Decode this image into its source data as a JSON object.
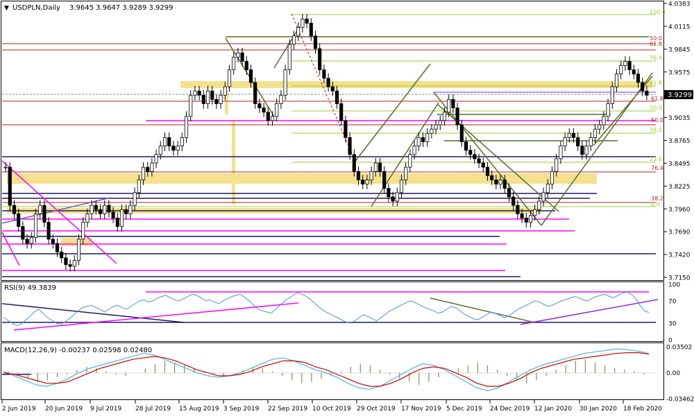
{
  "header": {
    "symbol": "USDPLN,Daily",
    "ohlc": "3.9645 3.9647 3.9289 3.9299"
  },
  "chart_data": [
    {
      "type": "candlestick",
      "panel": "price",
      "symbol": "USDPLN",
      "timeframe": "Daily",
      "open": 3.9645,
      "high": 3.9647,
      "low": 3.9289,
      "close": 3.9299,
      "current_price_label": "3.9299",
      "ylim": [
        3.715,
        4.0383
      ],
      "y_ticks": [
        "4.0383",
        "4.0115",
        "3.9845",
        "3.9575",
        "3.9305",
        "3.9035",
        "3.8765",
        "3.8495",
        "3.8225",
        "3.7960",
        "3.7690",
        "3.7420",
        "3.7150"
      ],
      "x_ticks": [
        "2 Jun 2019",
        "20 Jun 2019",
        "9 Jul 2019",
        "28 Jul 2019",
        "15 Aug 2019",
        "3 Sep 2019",
        "22 Sep 2019",
        "10 Oct 2019",
        "29 Oct 2019",
        "17 Nov 2019",
        "5 Dec 2019",
        "24 Dec 2019",
        "12 Jan 2020",
        "30 Jan 2020",
        "18 Feb 2020"
      ],
      "closes": [
        3.845,
        3.8,
        3.79,
        3.775,
        3.76,
        3.755,
        3.762,
        3.79,
        3.8,
        3.78,
        3.76,
        3.755,
        3.745,
        3.738,
        3.73,
        3.728,
        3.735,
        3.76,
        3.78,
        3.79,
        3.8,
        3.795,
        3.79,
        3.8,
        3.792,
        3.785,
        3.775,
        3.795,
        3.79,
        3.8,
        3.815,
        3.83,
        3.845,
        3.84,
        3.85,
        3.86,
        3.87,
        3.88,
        3.87,
        3.865,
        3.87,
        3.88,
        3.905,
        3.93,
        3.935,
        3.93,
        3.92,
        3.935,
        3.925,
        3.92,
        3.93,
        3.94,
        3.96,
        3.975,
        3.98,
        3.97,
        3.96,
        3.945,
        3.92,
        3.915,
        3.91,
        3.9,
        3.905,
        3.92,
        3.93,
        3.96,
        3.99,
        4.0,
        4.01,
        4.02,
        4.015,
        4.0,
        3.985,
        3.96,
        3.95,
        3.94,
        3.935,
        3.92,
        3.9,
        3.88,
        3.86,
        3.84,
        3.83,
        3.825,
        3.83,
        3.84,
        3.85,
        3.84,
        3.82,
        3.81,
        3.805,
        3.815,
        3.83,
        3.845,
        3.86,
        3.87,
        3.88,
        3.875,
        3.885,
        3.89,
        3.895,
        3.9,
        3.91,
        3.925,
        3.915,
        3.895,
        3.875,
        3.865,
        3.86,
        3.855,
        3.85,
        3.845,
        3.835,
        3.83,
        3.825,
        3.83,
        3.82,
        3.81,
        3.8,
        3.79,
        3.785,
        3.78,
        3.788,
        3.795,
        3.805,
        3.815,
        3.825,
        3.84,
        3.855,
        3.87,
        3.88,
        3.885,
        3.88,
        3.87,
        3.86,
        3.87,
        3.88,
        3.89,
        3.895,
        3.905,
        3.92,
        3.94,
        3.955,
        3.965,
        3.97,
        3.96,
        3.955,
        3.945,
        3.935,
        3.93
      ],
      "fib_left_labels": [
        "100.0",
        "50.0",
        "61.8",
        "76.4",
        "61.8",
        "50.0",
        "38.2",
        "23.6"
      ],
      "fib_right_labels": [
        "61.8",
        "50.0",
        "76.4",
        "38.2",
        "0.0"
      ],
      "colors": {
        "candles": "#000000",
        "green_lines": "#6b8e23",
        "fib_lines": "#9acd32",
        "resistance": "#b22222",
        "support": "#1a1a5e",
        "magenta": "#ff00ff",
        "zones": "#f5e08c",
        "rsi": "#4a90e2",
        "macd_signal": "#d00000",
        "macd_main": "#4ab4d8",
        "histogram": "#8b8b5a"
      }
    },
    {
      "type": "line",
      "panel": "rsi",
      "title": "RSI(9) 49.3839",
      "ylim": [
        0,
        100
      ],
      "y_ticks": [
        "100",
        "70",
        "30",
        "0"
      ],
      "values": [
        40,
        35,
        30,
        25,
        28,
        35,
        42,
        50,
        55,
        48,
        40,
        35,
        30,
        28,
        32,
        38,
        45,
        52,
        58,
        60,
        62,
        58,
        55,
        50,
        55,
        60,
        62,
        58,
        55,
        60,
        65,
        70,
        72,
        68,
        70,
        75,
        78,
        80,
        76,
        72,
        70,
        74,
        78,
        82,
        80,
        76,
        70,
        72,
        68,
        65,
        70,
        74,
        78,
        80,
        82,
        76,
        70,
        62,
        55,
        52,
        50,
        48,
        55,
        62,
        70,
        75,
        80,
        85,
        82,
        78,
        72,
        65,
        58,
        52,
        48,
        44,
        40,
        36,
        32,
        30,
        34,
        40,
        45,
        42,
        38,
        34,
        40,
        46,
        52,
        56,
        60,
        64,
        68,
        70,
        66,
        62,
        58,
        55,
        52,
        48,
        50,
        55,
        60,
        58,
        52,
        46,
        42,
        38,
        36,
        40,
        45,
        50,
        48,
        44,
        40,
        42,
        48,
        54,
        58,
        62,
        66,
        70,
        68,
        64,
        60,
        62,
        66,
        70,
        72,
        75,
        78,
        76,
        72,
        70,
        74,
        78,
        80,
        82,
        78,
        76,
        80,
        84,
        86,
        82,
        74,
        62,
        52,
        49.4
      ]
    },
    {
      "type": "bar",
      "panel": "macd",
      "title": "MACD(12,26,9) -0.00237 0.02598 0.02480",
      "ylim": [
        -0.03462,
        0.03502
      ],
      "y_ticks": [
        "0.03502",
        "0.00",
        "-0.03462"
      ],
      "histogram": [
        0.002,
        -0.004,
        -0.008,
        -0.012,
        -0.01,
        -0.006,
        -0.002,
        0.004,
        0.008,
        0.006,
        0.002,
        -0.002,
        -0.004,
        0.0,
        0.006,
        0.012,
        0.016,
        0.014,
        0.01,
        0.006,
        0.002,
        -0.002,
        -0.004,
        0.0,
        0.004,
        0.008,
        0.006,
        0.002,
        -0.004,
        -0.01,
        -0.014,
        -0.012,
        -0.008,
        -0.004,
        0.002,
        0.008,
        0.012,
        0.01,
        0.004,
        -0.002,
        -0.008,
        -0.012,
        -0.016,
        -0.012,
        -0.006,
        0.0,
        0.006,
        0.01,
        0.014,
        0.01,
        0.004,
        -0.004,
        -0.01,
        -0.014,
        -0.01,
        -0.004,
        0.004,
        0.01,
        0.016,
        0.018,
        0.014,
        0.01,
        0.006,
        0.004,
        0.002,
        -0.002
      ],
      "macd_line": [
        0.002,
        -0.004,
        -0.01,
        -0.016,
        -0.018,
        -0.014,
        -0.008,
        0.0,
        0.006,
        0.01,
        0.014,
        0.018,
        0.022,
        0.026,
        0.024,
        0.018,
        0.012,
        0.006,
        0.0,
        -0.004,
        -0.006,
        -0.004,
        0.0,
        0.006,
        0.012,
        0.018,
        0.02,
        0.016,
        0.01,
        0.004,
        0.0,
        -0.006,
        -0.014,
        -0.02,
        -0.022,
        -0.018,
        -0.01,
        -0.002,
        0.006,
        0.012,
        0.01,
        0.004,
        -0.004,
        -0.012,
        -0.02,
        -0.024,
        -0.02,
        -0.012,
        -0.004,
        0.004,
        0.01,
        0.014,
        0.018,
        0.022,
        0.026,
        0.028,
        0.03,
        0.032,
        0.031,
        0.029,
        0.026
      ],
      "signal_line": [
        0.0,
        -0.002,
        -0.006,
        -0.01,
        -0.014,
        -0.014,
        -0.012,
        -0.006,
        0.0,
        0.006,
        0.01,
        0.014,
        0.018,
        0.02,
        0.022,
        0.02,
        0.016,
        0.01,
        0.004,
        0.0,
        -0.004,
        -0.004,
        -0.002,
        0.002,
        0.008,
        0.012,
        0.016,
        0.016,
        0.014,
        0.008,
        0.004,
        -0.002,
        -0.008,
        -0.014,
        -0.018,
        -0.018,
        -0.014,
        -0.008,
        0.0,
        0.006,
        0.008,
        0.006,
        0.0,
        -0.006,
        -0.014,
        -0.018,
        -0.018,
        -0.014,
        -0.008,
        0.0,
        0.006,
        0.01,
        0.014,
        0.018,
        0.02,
        0.022,
        0.024,
        0.026,
        0.027,
        0.027,
        0.025
      ]
    }
  ]
}
